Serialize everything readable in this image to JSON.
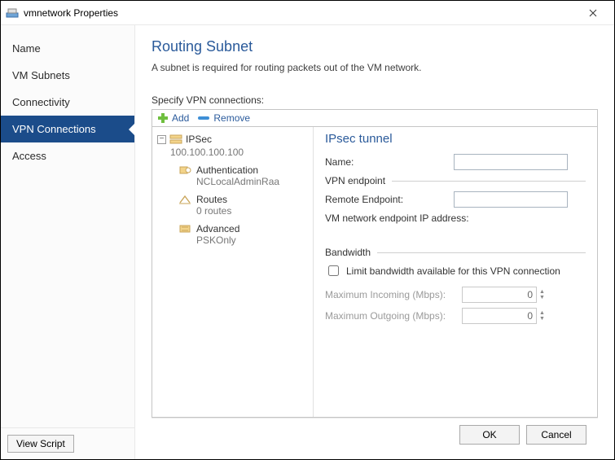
{
  "window": {
    "title": "vmnetwork Properties"
  },
  "sidebar": {
    "items": [
      {
        "label": "Name"
      },
      {
        "label": "VM Subnets"
      },
      {
        "label": "Connectivity"
      },
      {
        "label": "VPN Connections"
      },
      {
        "label": "Access"
      }
    ],
    "view_script": "View Script"
  },
  "page": {
    "title": "Routing Subnet",
    "desc": "A subnet is required for routing packets out of the VM network.",
    "specify": "Specify VPN connections:"
  },
  "toolbar": {
    "add": "Add",
    "remove": "Remove"
  },
  "tree": {
    "root": "IPSec",
    "root_ip": "100.100.100.100",
    "auth_label": "Authentication",
    "auth_value": "NCLocalAdminRaa",
    "routes_label": "Routes",
    "routes_value": "0 routes",
    "adv_label": "Advanced",
    "adv_value": "PSKOnly"
  },
  "detail": {
    "title": "IPsec tunnel",
    "name_label": "Name:",
    "name_value": "",
    "vpn_ep_section": "VPN endpoint",
    "remote_label": "Remote Endpoint:",
    "remote_value": "",
    "vm_ep_label": "VM network endpoint IP address:",
    "bw_section": "Bandwidth",
    "bw_check": "Limit bandwidth available for this VPN connection",
    "max_in_label": "Maximum Incoming (Mbps):",
    "max_in_value": "0",
    "max_out_label": "Maximum Outgoing (Mbps):",
    "max_out_value": "0"
  },
  "buttons": {
    "ok": "OK",
    "cancel": "Cancel"
  }
}
